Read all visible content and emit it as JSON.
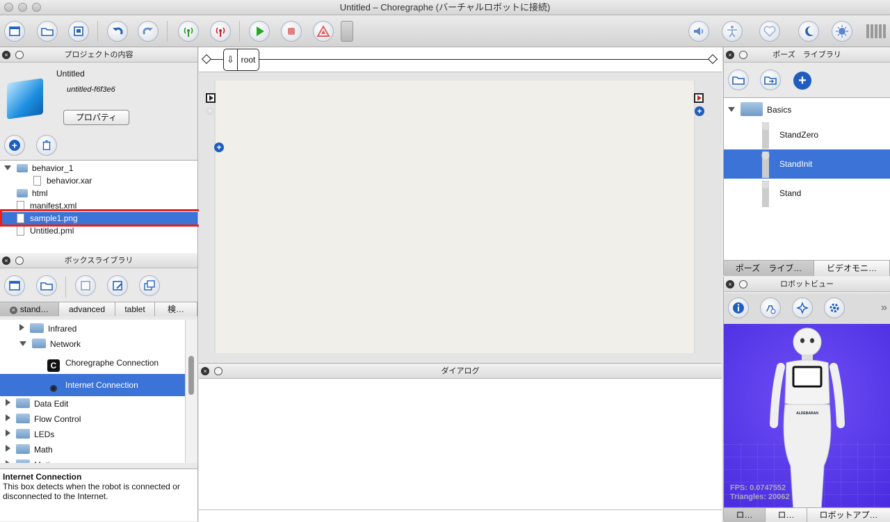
{
  "window": {
    "title": "Untitled – Choregraphe (バーチャルロボットに接続)"
  },
  "project": {
    "header": "プロジェクトの内容",
    "name": "Untitled",
    "id": "untitled-f6f3e6",
    "properties_button": "プロパティ",
    "files": [
      {
        "label": "behavior_1",
        "kind": "folder",
        "indent": 0,
        "expanded": true
      },
      {
        "label": "behavior.xar",
        "kind": "file",
        "indent": 1
      },
      {
        "label": "html",
        "kind": "folder",
        "indent": 0
      },
      {
        "label": "manifest.xml",
        "kind": "file",
        "indent": 0
      },
      {
        "label": "sample1.png",
        "kind": "file",
        "indent": 0,
        "selected": true
      },
      {
        "label": "Untitled.pml",
        "kind": "file",
        "indent": 0
      }
    ]
  },
  "boxlib": {
    "header": "ボックスライブラリ",
    "tabs": [
      "stand…",
      "advanced",
      "tablet",
      "検…"
    ],
    "items": [
      {
        "label": "Infrared",
        "kind": "folder",
        "level": 1,
        "state": "collapsed"
      },
      {
        "label": "Network",
        "kind": "folder",
        "level": 1,
        "state": "expanded"
      },
      {
        "label": "Choregraphe Connection",
        "kind": "box",
        "level": 2
      },
      {
        "label": "Internet Connection",
        "kind": "box",
        "level": 2,
        "selected": true
      },
      {
        "label": "Data Edit",
        "kind": "folder",
        "level": 0,
        "state": "collapsed"
      },
      {
        "label": "Flow Control",
        "kind": "folder",
        "level": 0,
        "state": "collapsed"
      },
      {
        "label": "LEDs",
        "kind": "folder",
        "level": 0,
        "state": "collapsed"
      },
      {
        "label": "Math",
        "kind": "folder",
        "level": 0,
        "state": "collapsed"
      },
      {
        "label": "Motions",
        "kind": "folder",
        "level": 0,
        "state": "collapsed"
      }
    ],
    "desc_title": "Internet Connection",
    "desc_text": "This box detects when the robot is connected or disconnected to the Internet."
  },
  "flow": {
    "breadcrumb": "root"
  },
  "dialog": {
    "header": "ダイアログ"
  },
  "poses": {
    "header": "ポーズ　ライブラリ",
    "folder": "Basics",
    "items": [
      {
        "label": "StandZero"
      },
      {
        "label": "StandInit",
        "selected": true
      },
      {
        "label": "Stand"
      }
    ],
    "tabs": [
      "ポーズ　ライブ…",
      "ビデオモニ…"
    ]
  },
  "robotview": {
    "header": "ロボットビュー",
    "fps": "FPS: 0.0747552",
    "triangles": "Triangles: 20062",
    "chest": "ALDEBARAN",
    "tabs": [
      "ロ…",
      "ロ…",
      "ロボットアプ…"
    ],
    "more": "»"
  },
  "colors": {
    "selection": "#3b73d6",
    "robot_bg": "#5a3bef"
  }
}
